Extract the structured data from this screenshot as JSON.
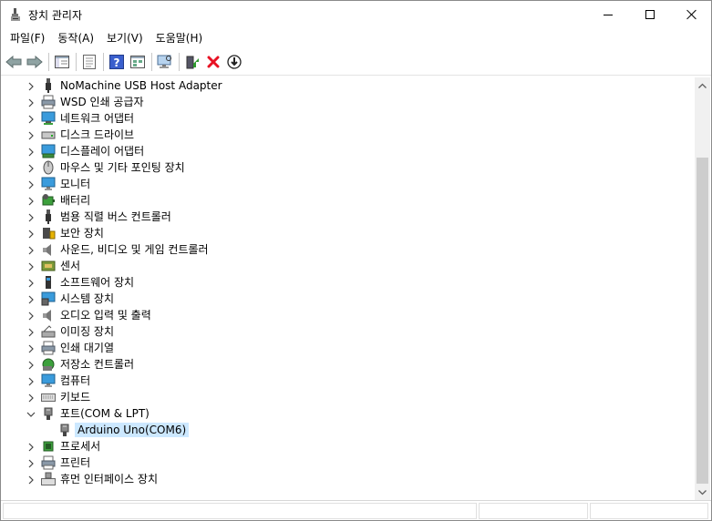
{
  "window": {
    "title": "장치 관리자"
  },
  "menu": [
    {
      "label": "파일(F)"
    },
    {
      "label": "동작(A)"
    },
    {
      "label": "보기(V)"
    },
    {
      "label": "도움말(H)"
    }
  ],
  "toolbar": [
    {
      "name": "back-icon"
    },
    {
      "name": "forward-icon"
    },
    {
      "name": "sep"
    },
    {
      "name": "properties-pane-icon"
    },
    {
      "name": "sep"
    },
    {
      "name": "properties-icon"
    },
    {
      "name": "sep"
    },
    {
      "name": "help-icon"
    },
    {
      "name": "view-icon"
    },
    {
      "name": "sep"
    },
    {
      "name": "scan-hardware-icon"
    },
    {
      "name": "sep"
    },
    {
      "name": "update-driver-icon"
    },
    {
      "name": "uninstall-icon"
    },
    {
      "name": "disable-icon"
    }
  ],
  "tree": {
    "items": [
      {
        "label": "NoMachine USB Host Adapter",
        "icon": "usb-icon",
        "expanded": false
      },
      {
        "label": "WSD 인쇄 공급자",
        "icon": "printer-icon",
        "expanded": false
      },
      {
        "label": "네트워크 어댑터",
        "icon": "network-adapter-icon",
        "expanded": false
      },
      {
        "label": "디스크 드라이브",
        "icon": "disk-drive-icon",
        "expanded": false
      },
      {
        "label": "디스플레이 어댑터",
        "icon": "display-adapter-icon",
        "expanded": false
      },
      {
        "label": "마우스 및 기타 포인팅 장치",
        "icon": "mouse-icon",
        "expanded": false
      },
      {
        "label": "모니터",
        "icon": "monitor-icon",
        "expanded": false
      },
      {
        "label": "배터리",
        "icon": "battery-icon",
        "expanded": false
      },
      {
        "label": "범용 직렬 버스 컨트롤러",
        "icon": "usb-controller-icon",
        "expanded": false
      },
      {
        "label": "보안 장치",
        "icon": "security-device-icon",
        "expanded": false
      },
      {
        "label": "사운드, 비디오 및 게임 컨트롤러",
        "icon": "sound-icon",
        "expanded": false
      },
      {
        "label": "센서",
        "icon": "sensor-icon",
        "expanded": false
      },
      {
        "label": "소프트웨어 장치",
        "icon": "software-device-icon",
        "expanded": false
      },
      {
        "label": "시스템 장치",
        "icon": "system-device-icon",
        "expanded": false
      },
      {
        "label": "오디오 입력 및 출력",
        "icon": "audio-icon",
        "expanded": false
      },
      {
        "label": "이미징 장치",
        "icon": "imaging-device-icon",
        "expanded": false
      },
      {
        "label": "인쇄 대기열",
        "icon": "print-queue-icon",
        "expanded": false
      },
      {
        "label": "저장소 컨트롤러",
        "icon": "storage-controller-icon",
        "expanded": false
      },
      {
        "label": "컴퓨터",
        "icon": "computer-icon",
        "expanded": false
      },
      {
        "label": "키보드",
        "icon": "keyboard-icon",
        "expanded": false
      },
      {
        "label": "포트(COM & LPT)",
        "icon": "port-icon",
        "expanded": true,
        "children": [
          {
            "label": "Arduino Uno(COM6)",
            "icon": "port-icon",
            "selected": true
          }
        ]
      },
      {
        "label": "프로세서",
        "icon": "processor-icon",
        "expanded": false
      },
      {
        "label": "프린터",
        "icon": "printer-icon",
        "expanded": false
      },
      {
        "label": "휴먼 인터페이스 장치",
        "icon": "hid-icon",
        "expanded": false
      }
    ]
  },
  "colors": {
    "selection": "#cce8ff",
    "uninstall_red": "#e81123"
  }
}
